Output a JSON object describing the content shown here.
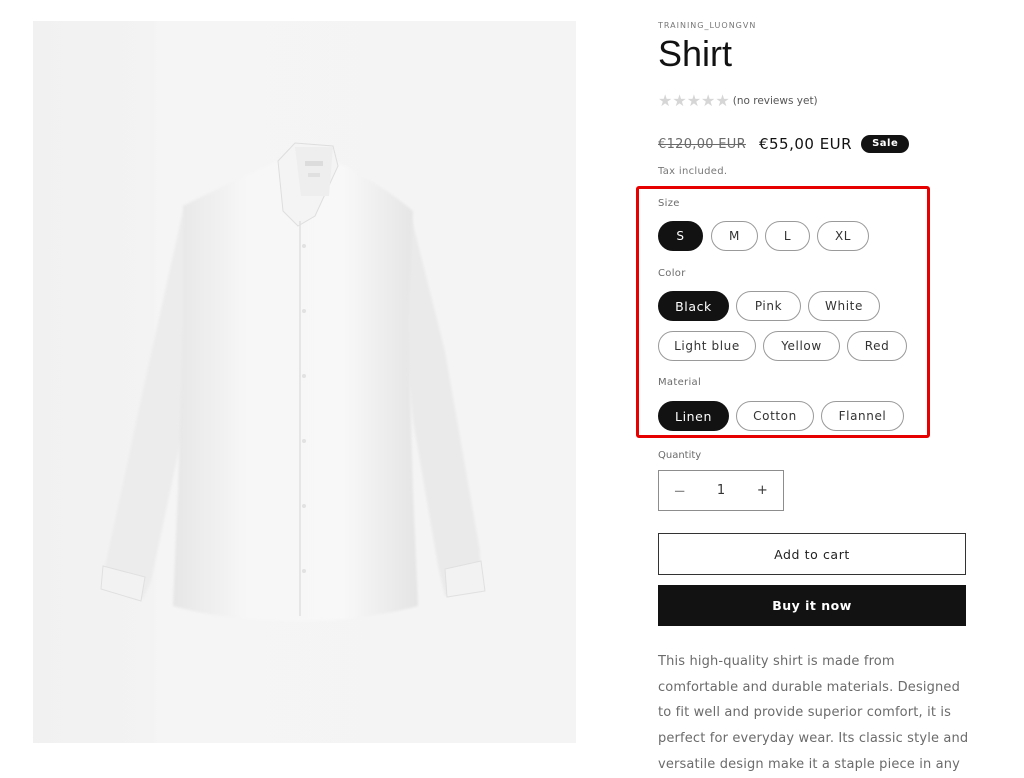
{
  "product": {
    "vendor": "TRAINING_LUONGVN",
    "title": "Shirt",
    "rating": {
      "stars_filled": 0,
      "stars_total": 5,
      "text": "(no reviews yet)"
    },
    "price": {
      "compare_at": "€120,00 EUR",
      "sale": "€55,00 EUR",
      "badge": "Sale",
      "tax_note": "Tax included."
    },
    "image_alt": "White long-sleeve shirt"
  },
  "options": {
    "size": {
      "label": "Size",
      "selected": "S",
      "values": [
        "S",
        "M",
        "L",
        "XL"
      ]
    },
    "color": {
      "label": "Color",
      "selected": "Black",
      "values": [
        "Black",
        "Pink",
        "White",
        "Light blue",
        "Yellow",
        "Red"
      ]
    },
    "material": {
      "label": "Material",
      "selected": "Linen",
      "values": [
        "Linen",
        "Cotton",
        "Flannel"
      ]
    }
  },
  "quantity": {
    "label": "Quantity",
    "value": "1",
    "decrease_icon": "−",
    "increase_icon": "+"
  },
  "actions": {
    "add_to_cart": "Add to cart",
    "buy_now": "Buy it now"
  },
  "description": "This high-quality shirt is made from comfortable and durable materials. Designed to fit well and provide superior comfort, it is perfect for everyday wear. Its classic style and versatile design make it a staple piece in any",
  "annotation": {
    "highlight_color": "#e60000"
  }
}
